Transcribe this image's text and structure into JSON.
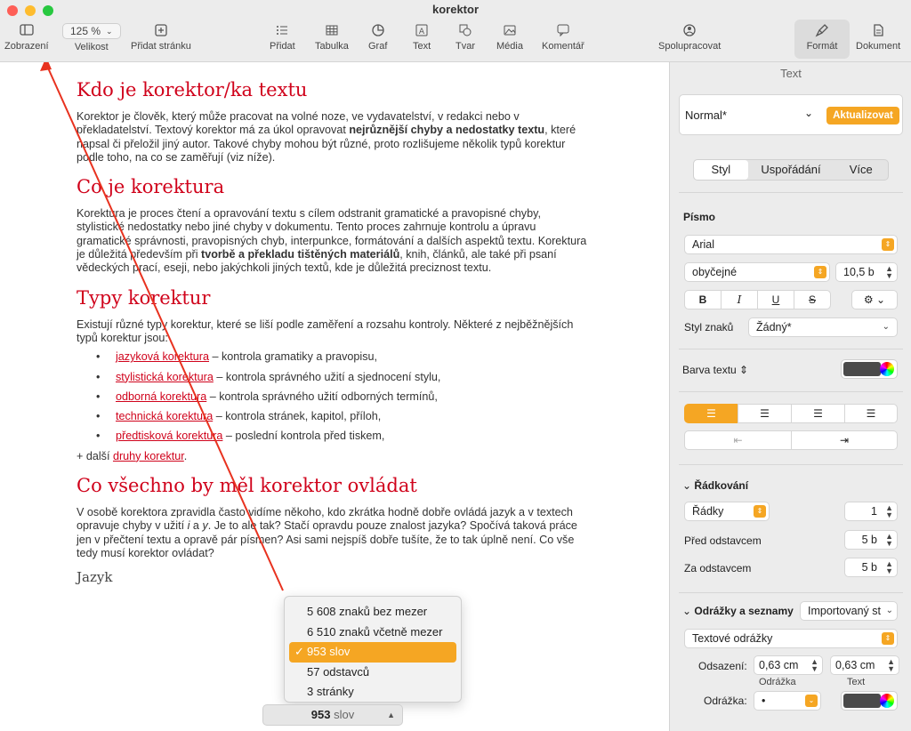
{
  "window": {
    "title": "korektor"
  },
  "toolbar": {
    "zobrazeni": "Zobrazení",
    "zoom_value": "125 %",
    "velikost": "Velikost",
    "pridat_stranku": "Přidat stránku",
    "pridat": "Přidat",
    "tabulka": "Tabulka",
    "graf": "Graf",
    "text": "Text",
    "tvar": "Tvar",
    "media": "Média",
    "komentar": "Komentář",
    "spolupracovat": "Spolupracovat",
    "format": "Formát",
    "dokument": "Dokument"
  },
  "doc": {
    "h1": "Kdo je korektor/ka textu",
    "p1_a": "Korektor je člověk, který může pracovat na volné noze, ve vydavatelství, v redakci nebo v překladatelství. Textový korektor má za úkol opravovat ",
    "p1_b": "nejrůznější chyby a nedostatky textu",
    "p1_c": ", které napsal či přeložil jiný autor. Takové chyby mohou být různé, proto rozlišujeme několik typů korektur podle toho, na co se zaměřují (viz níže).",
    "h2": "Co je korektura",
    "p2_a": "Korektura je proces čtení a opravování textu s cílem odstranit gramatické a pravopisné chyby, stylistické nedostatky nebo jiné chyby v dokumentu. Tento proces zahrnuje kontrolu a úpravu gramatické správnosti, pravopisných chyb, interpunkce, formátování a dalších aspektů textu. Korektura je důležitá především při ",
    "p2_b": "tvorbě a překladu tištěných materiálů",
    "p2_c": ", knih, článků, ale také při psaní vědeckých prací, eseji, nebo jakýchkoli jiných textů, kde je důležitá preciznost textu.",
    "h3": "Typy korektur",
    "p3": "Existují různé typy korektur, které se liší podle zaměření a rozsahu kontroly. Některé z nejběžnějších typů korektur jsou:",
    "list": [
      {
        "link": "jazyková korektura",
        "rest": " – kontrola gramatiky a pravopisu,"
      },
      {
        "link": "stylistická korektura",
        "rest": " – kontrola správného užití a sjednocení stylu,"
      },
      {
        "link": "odborná korektura",
        "rest": " – kontrola správného užití odborných termínů,"
      },
      {
        "link": "technická korektura",
        "rest": " – kontrola stránek, kapitol, příloh,"
      },
      {
        "link": "předtisková korektura",
        "rest": " – poslední kontrola před tiskem,"
      }
    ],
    "more_a": "+ další ",
    "more_link": "druhy korektur",
    "more_c": ".",
    "h4": "Co všechno by měl korektor ovládat",
    "p4_a": "V osobě korektora zpravidla často vidíme někoho, kdo zkrátka hodně dobře ovládá jazyk a v textech opravuje chyby v užití ",
    "p4_i": "i",
    "p4_b": " a ",
    "p4_y": "y",
    "p4_c": ". Je to ale tak? Stačí opravdu pouze znalost jazyka? Spočívá taková práce jen v přečtení textu a opravě pár písmen? Asi sami nejspíš dobře tušíte, že to tak úplně není. Co vše tedy musí korektor ovládat?",
    "h5": "Jazyk"
  },
  "wordcount": {
    "options": [
      "5 608 znaků bez mezer",
      "6 510 znaků včetně mezer",
      "953 slov",
      "57 odstavců",
      "3 stránky"
    ],
    "selected_check": "✓",
    "bar_number": "953",
    "bar_unit": "slov"
  },
  "sidebar": {
    "title": "Text",
    "style_name": "Normal*",
    "update_btn": "Aktualizovat",
    "tabs": [
      "Styl",
      "Uspořádání",
      "Více"
    ],
    "pismo": "Písmo",
    "font_name": "Arial",
    "font_weight": "obyčejné",
    "font_size": "10,5 b",
    "b": "B",
    "i": "I",
    "u": "U",
    "s": "S",
    "styl_znaku_label": "Styl znaků",
    "styl_znaku_value": "Žádný*",
    "barva_textu": "Barva textu",
    "radkovani": "Řádkování",
    "radky": "Řádky",
    "radky_value": "1",
    "pred_label": "Před odstavcem",
    "pred_value": "5 b",
    "za_label": "Za odstavcem",
    "za_value": "5 b",
    "odrazky_label": "Odrážky a seznamy",
    "odrazky_value": "Importovaný st",
    "textove_odrazky": "Textové odrážky",
    "odsazeni": "Odsazení:",
    "odsazeni_1": "0,63 cm",
    "odsazeni_2": "0,63 cm",
    "odrazka_sub": "Odrážka",
    "text_sub": "Text",
    "odrazka_label": "Odrážka:",
    "odrazka_value": "•"
  },
  "colors": {
    "accent": "#f5a623",
    "heading": "#d0021b"
  }
}
